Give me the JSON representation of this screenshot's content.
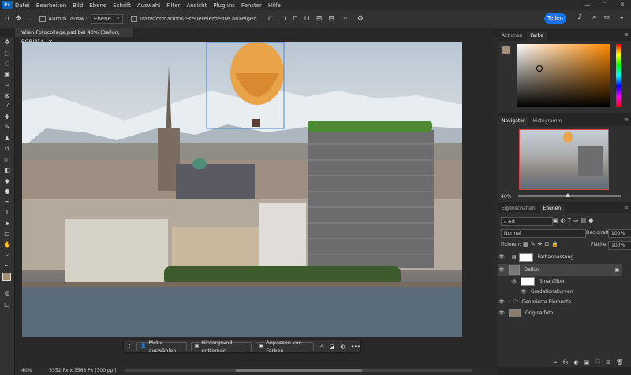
{
  "app": {
    "logo_text": "Ps",
    "menu": [
      "Datei",
      "Bearbeiten",
      "Bild",
      "Ebene",
      "Schrift",
      "Auswahl",
      "Filter",
      "Ansicht",
      "Plug-ins",
      "Fenster",
      "Hilfe"
    ],
    "window_controls": [
      "—",
      "❐",
      "✕"
    ]
  },
  "options_bar": {
    "auto_select_label": "Autom. ausw.:",
    "auto_select_value": "Ebene",
    "transform_label": "Transformations-Steuerelemente anzeigen",
    "share_label": "Teilen"
  },
  "document": {
    "tab_title": "Wien-Fotocollage.psd bei 40% (Ballon, RGB/8) *",
    "tab_close": "✕",
    "zoom": "40%",
    "size_info": "5352 Px x 3568 Px (300 ppi)"
  },
  "context_bar": {
    "select_subject": "Motiv auswählen",
    "remove_background": "Hintergrund entfernen",
    "adjust_colors": "Anpassen von Farben",
    "more": "•••"
  },
  "panels": {
    "color": {
      "tabs": [
        "Aktionen",
        "Farbe"
      ],
      "active": "Farbe",
      "foreground": "#a58f77",
      "background": "#ffffff",
      "hue": "#ff8a00"
    },
    "navigator": {
      "tabs": [
        "Navigator",
        "Histogramm"
      ],
      "active": "Navigator",
      "zoom": "40%"
    },
    "layers": {
      "tabs": [
        "Eigenschaften",
        "Ebenen"
      ],
      "active": "Ebenen",
      "filter_value": "Art",
      "blend_mode": "Normal",
      "opacity_label": "Deckkraft:",
      "opacity_value": "100%",
      "lock_label": "Fixieren:",
      "fill_label": "Fläche:",
      "fill_value": "100%",
      "items": [
        {
          "name": "Farbanpassung",
          "selected": false
        },
        {
          "name": "Ballon",
          "selected": true
        },
        {
          "name": "Smartfilter",
          "selected": false
        },
        {
          "name": "Gradationskurven",
          "selected": false
        },
        {
          "name": "Generierte Elemente",
          "selected": false
        },
        {
          "name": "Originalfoto",
          "selected": false
        }
      ],
      "footer_icons": [
        "∞",
        "fx",
        "◐",
        "▣",
        "🗀",
        "⊞",
        "🗑"
      ]
    }
  }
}
